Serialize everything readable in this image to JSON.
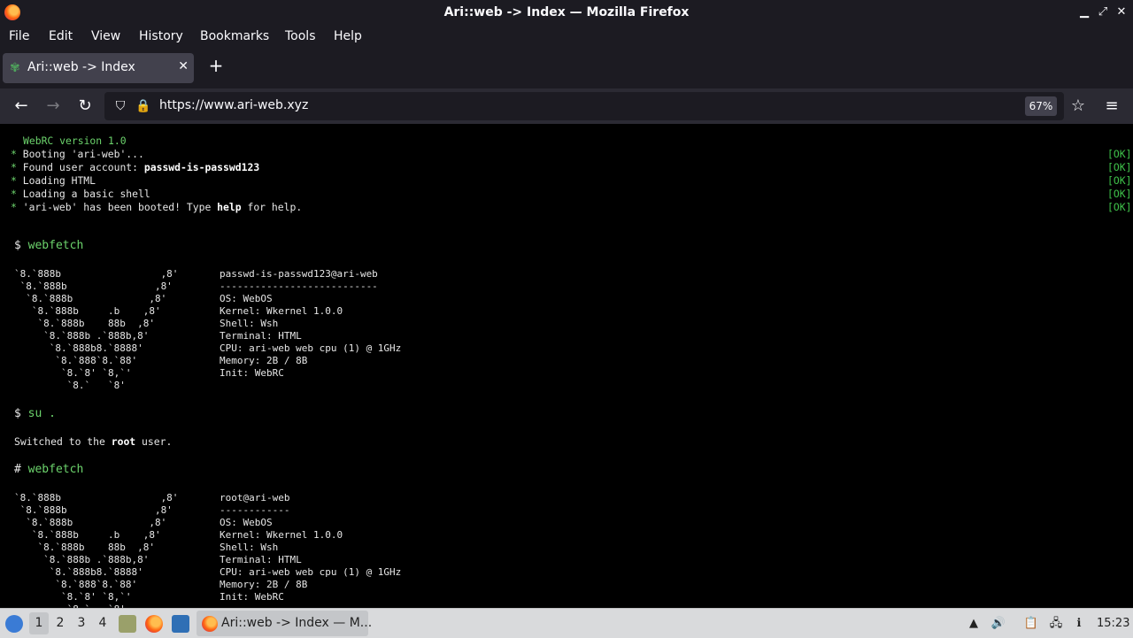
{
  "window": {
    "title": "Ari::web -> Index — Mozilla Firefox",
    "minimize_icon": "minimize-icon",
    "maximize_icon": "maximize-icon",
    "close_icon": "close-icon"
  },
  "menu": [
    "File",
    "Edit",
    "View",
    "History",
    "Bookmarks",
    "Tools",
    "Help"
  ],
  "tab": {
    "label": "Ari::web -> Index",
    "favicon_glyph": "✾"
  },
  "nav": {
    "url": "https://www.ari-web.xyz",
    "zoom": "67%"
  },
  "terminal": {
    "version_line": "WebRC version 1.0",
    "boot_lines": [
      {
        "bullet": "*",
        "text": "Booting 'ari-web'...",
        "bold": "",
        "after": "",
        "status": "[OK]"
      },
      {
        "bullet": "*",
        "text": "Found user account: ",
        "bold": "passwd-is-passwd123",
        "after": "",
        "status": "[OK]"
      },
      {
        "bullet": "*",
        "text": "Loading HTML",
        "bold": "",
        "after": "",
        "status": "[OK]"
      },
      {
        "bullet": "*",
        "text": "Loading a basic shell",
        "bold": "",
        "after": "",
        "status": "[OK]"
      },
      {
        "bullet": "*",
        "text": "'ari-web' has been booted! Type ",
        "bold": "help",
        "after": " for help.",
        "status": "[OK]"
      }
    ],
    "cmd1": {
      "prompt": "$",
      "command": "webfetch"
    },
    "ascii_art": "`8.`888b                 ,8'\n `8.`888b               ,8'\n  `8.`888b             ,8'\n   `8.`888b     .b    ,8'\n    `8.`888b    88b  ,8'\n     `8.`888b .`888b,8'\n      `8.`888b8.`8888'\n       `8.`888`8.`88'\n        `8.`8' `8,`'\n         `8.`   `8'",
    "fetch1": [
      "passwd-is-passwd123@ari-web",
      "---------------------------",
      "OS: WebOS",
      "Kernel: Wkernel 1.0.0",
      "Shell: Wsh",
      "Terminal: HTML",
      "CPU: ari-web web cpu (1) @ 1GHz",
      "Memory: 2B / 8B",
      "Init: WebRC"
    ],
    "cmd2": {
      "prompt": "$",
      "command": "su ."
    },
    "switch_msg": {
      "before": "Switched to the ",
      "bold": "root",
      "after": " user."
    },
    "cmd3": {
      "prompt": "#",
      "command": "webfetch"
    },
    "fetch2": [
      "root@ari-web",
      "------------",
      "OS: WebOS",
      "Kernel: Wkernel 1.0.0",
      "Shell: Wsh",
      "Terminal: HTML",
      "CPU: ari-web web cpu (1) @ 1GHz",
      "Memory: 2B / 8B",
      "Init: WebRC"
    ]
  },
  "taskbar": {
    "workspaces": [
      "1",
      "2",
      "3",
      "4"
    ],
    "window_label": "Ari::web -> Index — M...",
    "clock": "15:23"
  }
}
